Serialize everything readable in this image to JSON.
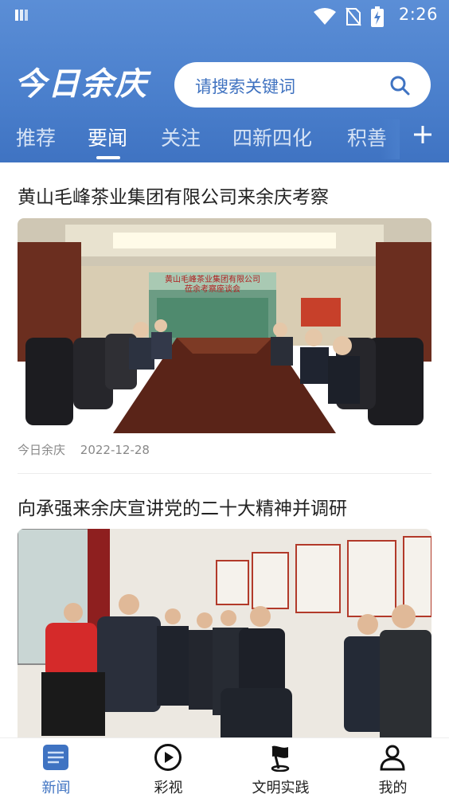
{
  "status_bar": {
    "time": "2:26"
  },
  "header": {
    "logo_text": "今日余庆",
    "search_placeholder": "请搜索关键词"
  },
  "tabs": [
    {
      "label": "推荐",
      "active": false
    },
    {
      "label": "要闻",
      "active": true
    },
    {
      "label": "关注",
      "active": false
    },
    {
      "label": "四新四化",
      "active": false
    },
    {
      "label": "积善",
      "active": false
    }
  ],
  "articles": [
    {
      "title": "黄山毛峰茶业集团有限公司来余庆考察",
      "banner_line1": "黄山毛峰茶业集团有限公司",
      "banner_line2": "莅余考察座谈会",
      "source": "今日余庆",
      "date": "2022-12-28"
    },
    {
      "title": "向承强来余庆宣讲党的二十大精神并调研"
    }
  ],
  "bottom_nav": [
    {
      "label": "新闻",
      "icon": "news-icon",
      "active": true
    },
    {
      "label": "彩视",
      "icon": "play-icon",
      "active": false
    },
    {
      "label": "文明实践",
      "icon": "flag-icon",
      "active": false
    },
    {
      "label": "我的",
      "icon": "user-icon",
      "active": false
    }
  ],
  "colors": {
    "header": "#4a7fcc",
    "accent": "#3f73c2"
  }
}
